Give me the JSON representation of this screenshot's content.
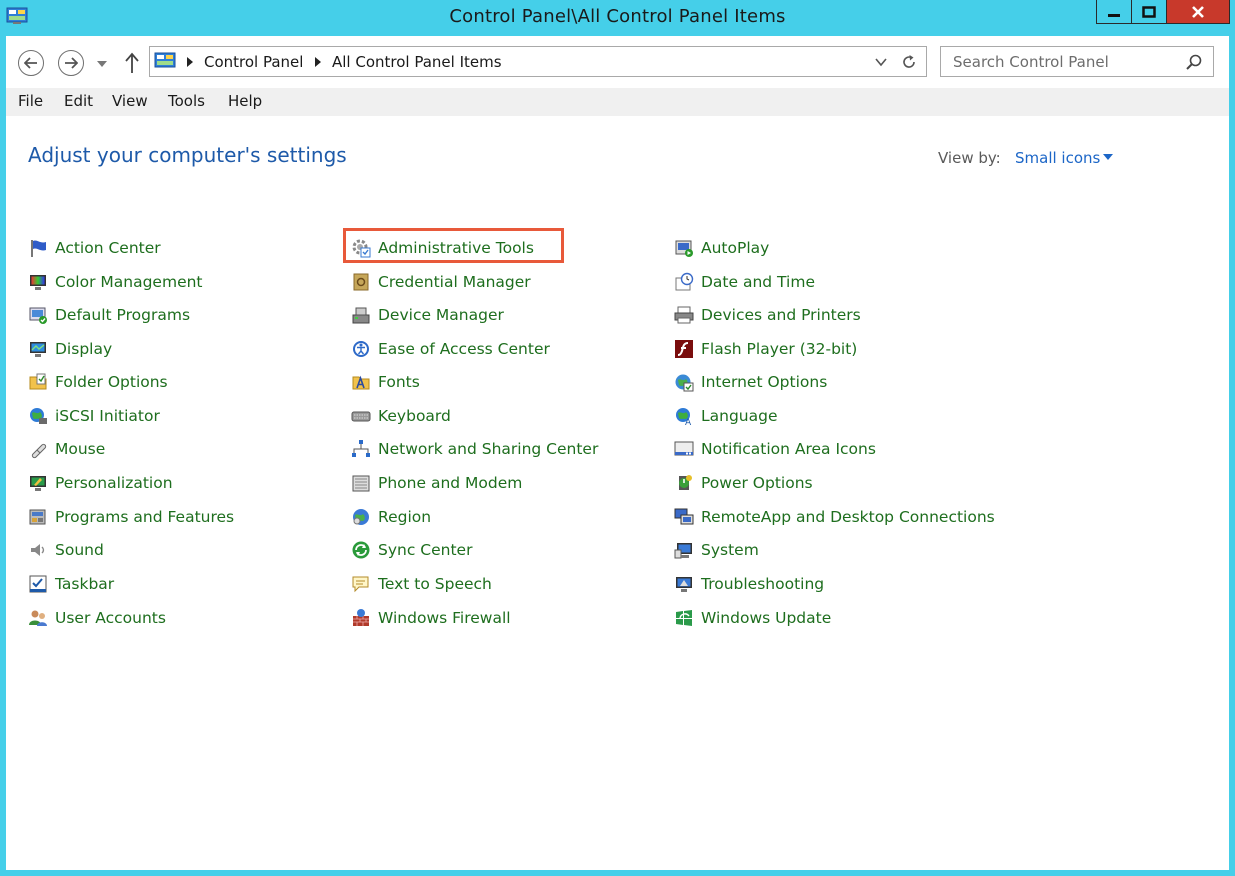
{
  "window": {
    "title": "Control Panel\\All Control Panel Items"
  },
  "address": {
    "crumbs": [
      "Control Panel",
      "All Control Panel Items"
    ]
  },
  "search": {
    "placeholder": "Search Control Panel"
  },
  "menu": [
    "File",
    "Edit",
    "View",
    "Tools",
    "Help"
  ],
  "content": {
    "title": "Adjust your computer's settings",
    "view_by_label": "View by:",
    "view_by_value": "Small icons"
  },
  "items": {
    "col1": [
      {
        "label": "Action Center",
        "icon": "flag-icon"
      },
      {
        "label": "Color Management",
        "icon": "color-management-icon"
      },
      {
        "label": "Default Programs",
        "icon": "default-programs-icon"
      },
      {
        "label": "Display",
        "icon": "display-icon"
      },
      {
        "label": "Folder Options",
        "icon": "folder-options-icon"
      },
      {
        "label": "iSCSI Initiator",
        "icon": "iscsi-globe-icon"
      },
      {
        "label": "Mouse",
        "icon": "mouse-icon"
      },
      {
        "label": "Personalization",
        "icon": "personalization-icon"
      },
      {
        "label": "Programs and Features",
        "icon": "programs-features-icon"
      },
      {
        "label": "Sound",
        "icon": "speaker-icon"
      },
      {
        "label": "Taskbar",
        "icon": "taskbar-icon"
      },
      {
        "label": "User Accounts",
        "icon": "user-accounts-icon"
      }
    ],
    "col2": [
      {
        "label": "Administrative Tools",
        "icon": "admin-tools-icon"
      },
      {
        "label": "Credential Manager",
        "icon": "credential-vault-icon"
      },
      {
        "label": "Device Manager",
        "icon": "device-manager-icon"
      },
      {
        "label": "Ease of Access Center",
        "icon": "ease-of-access-icon"
      },
      {
        "label": "Fonts",
        "icon": "fonts-folder-icon"
      },
      {
        "label": "Keyboard",
        "icon": "keyboard-icon"
      },
      {
        "label": "Network and Sharing Center",
        "icon": "network-icon"
      },
      {
        "label": "Phone and Modem",
        "icon": "phone-modem-icon"
      },
      {
        "label": "Region",
        "icon": "region-globe-icon"
      },
      {
        "label": "Sync Center",
        "icon": "sync-icon"
      },
      {
        "label": "Text to Speech",
        "icon": "speech-bubble-icon"
      },
      {
        "label": "Windows Firewall",
        "icon": "firewall-icon"
      }
    ],
    "col3": [
      {
        "label": "AutoPlay",
        "icon": "autoplay-icon"
      },
      {
        "label": "Date and Time",
        "icon": "clock-icon"
      },
      {
        "label": "Devices and Printers",
        "icon": "printer-icon"
      },
      {
        "label": "Flash Player (32-bit)",
        "icon": "flash-icon"
      },
      {
        "label": "Internet Options",
        "icon": "internet-globe-icon"
      },
      {
        "label": "Language",
        "icon": "language-icon"
      },
      {
        "label": "Notification Area Icons",
        "icon": "notification-icon"
      },
      {
        "label": "Power Options",
        "icon": "power-icon"
      },
      {
        "label": "RemoteApp and Desktop Connections",
        "icon": "remote-desktop-icon"
      },
      {
        "label": "System",
        "icon": "system-icon"
      },
      {
        "label": "Troubleshooting",
        "icon": "troubleshooting-icon"
      },
      {
        "label": "Windows Update",
        "icon": "windows-update-icon"
      }
    ]
  },
  "colors": {
    "frame": "#45cfe9",
    "link_green": "#1e6e1e",
    "title_blue": "#1e5aa9",
    "highlight": "#e8593a",
    "close_red": "#c8392b"
  }
}
